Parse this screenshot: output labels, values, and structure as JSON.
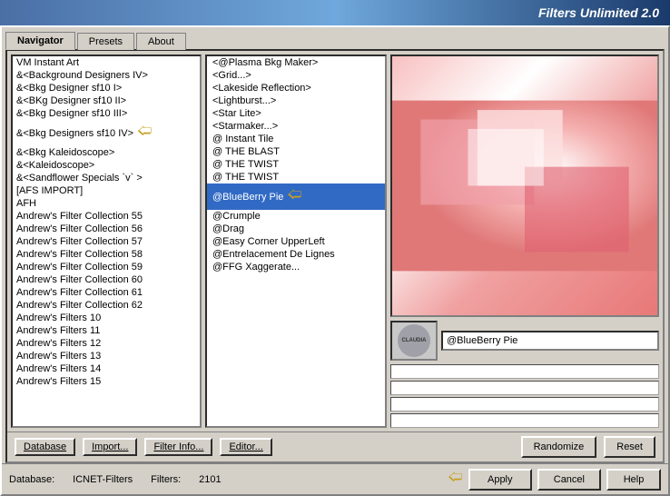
{
  "titleBar": {
    "text": "Filters Unlimited 2.0"
  },
  "tabs": [
    {
      "id": "navigator",
      "label": "Navigator",
      "active": true
    },
    {
      "id": "presets",
      "label": "Presets",
      "active": false
    },
    {
      "id": "about",
      "label": "About",
      "active": false
    }
  ],
  "leftPanel": {
    "items": [
      {
        "label": "VM Instant Art",
        "hasArrow": false
      },
      {
        "label": "&<Background Designers IV>",
        "hasArrow": false
      },
      {
        "label": "&<Bkg Designer sf10 I>",
        "hasArrow": false
      },
      {
        "label": "&<BKg Designer sf10 II>",
        "hasArrow": false
      },
      {
        "label": "&<Bkg Designer sf10 III>",
        "hasArrow": false
      },
      {
        "label": "&<Bkg Designers sf10 IV>",
        "hasArrow": true
      },
      {
        "label": "&<Bkg Kaleidoscope>",
        "hasArrow": false
      },
      {
        "label": "&<Kaleidoscope>",
        "hasArrow": false
      },
      {
        "label": "&<Sandflower Specials `v` >",
        "hasArrow": false
      },
      {
        "label": "[AFS IMPORT]",
        "hasArrow": false
      },
      {
        "label": "AFH",
        "hasArrow": false
      },
      {
        "label": "Andrew's Filter Collection 55",
        "hasArrow": false
      },
      {
        "label": "Andrew's Filter Collection 56",
        "hasArrow": false
      },
      {
        "label": "Andrew's Filter Collection 57",
        "hasArrow": false
      },
      {
        "label": "Andrew's Filter Collection 58",
        "hasArrow": false
      },
      {
        "label": "Andrew's Filter Collection 59",
        "hasArrow": false
      },
      {
        "label": "Andrew's Filter Collection 60",
        "hasArrow": false
      },
      {
        "label": "Andrew's Filter Collection 61",
        "hasArrow": false
      },
      {
        "label": "Andrew's Filter Collection 62",
        "hasArrow": false
      },
      {
        "label": "Andrew's Filters 10",
        "hasArrow": false
      },
      {
        "label": "Andrew's Filters 11",
        "hasArrow": false
      },
      {
        "label": "Andrew's Filters 12",
        "hasArrow": false
      },
      {
        "label": "Andrew's Filters 13",
        "hasArrow": false
      },
      {
        "label": "Andrew's Filters 14",
        "hasArrow": false
      },
      {
        "label": "Andrew's Filters 15",
        "hasArrow": false
      }
    ]
  },
  "middlePanel": {
    "items": [
      {
        "label": "<@Plasma Bkg Maker>",
        "selected": false
      },
      {
        "label": "<Grid...>",
        "selected": false
      },
      {
        "label": "<Lakeside Reflection>",
        "selected": false
      },
      {
        "label": "<Lightburst...>",
        "selected": false
      },
      {
        "label": "<Star Lite>",
        "selected": false
      },
      {
        "label": "<Starmaker...>",
        "selected": false
      },
      {
        "label": "@ Instant Tile",
        "selected": false
      },
      {
        "label": "@ THE BLAST",
        "selected": false
      },
      {
        "label": "@ THE TWIST",
        "selected": false
      },
      {
        "label": "@ THE TWIST",
        "selected": false
      },
      {
        "label": "@BlueBerry Pie",
        "selected": true,
        "hasArrow": true
      },
      {
        "label": "@Crumple",
        "selected": false
      },
      {
        "label": "@Drag",
        "selected": false
      },
      {
        "label": "@Easy Corner UpperLeft",
        "selected": false
      },
      {
        "label": "@Entrelacement De Lignes",
        "selected": false
      },
      {
        "label": "@FFG Xaggerate...",
        "selected": false
      }
    ]
  },
  "rightPanel": {
    "filterNameLabel": "@BlueBerry Pie",
    "avatarText": "CLAUDIA",
    "emptyRows": 4
  },
  "bottomToolbar": {
    "databaseBtn": "Database",
    "importBtn": "Import...",
    "filterInfoBtn": "Filter Info...",
    "editorBtn": "Editor...",
    "randomizeBtn": "Randomize",
    "resetBtn": "Reset"
  },
  "statusBar": {
    "databaseLabel": "Database:",
    "databaseValue": "ICNET-Filters",
    "filtersLabel": "Filters:",
    "filtersValue": "2101"
  },
  "bottomButtons": {
    "applyBtn": "Apply",
    "cancelBtn": "Cancel",
    "helpBtn": "Help"
  }
}
